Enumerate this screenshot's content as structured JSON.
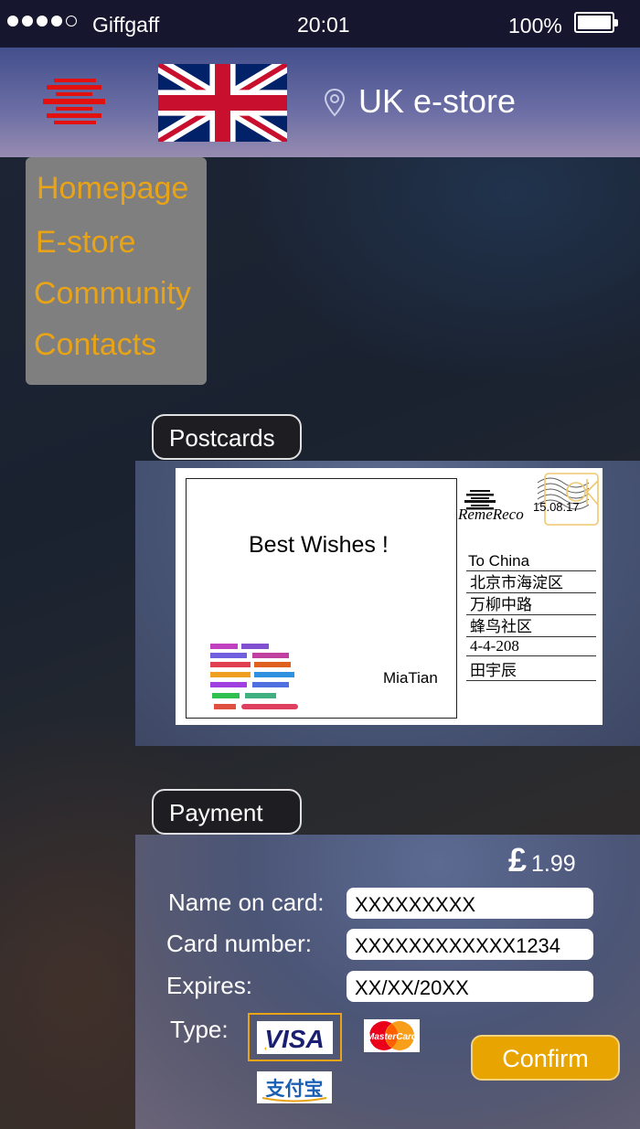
{
  "status_bar": {
    "carrier": "Giffgaff",
    "time": "20:01",
    "battery": "100%",
    "signal_bars": 4,
    "signal_max": 5
  },
  "header": {
    "title": "UK e-store",
    "menu_icon": "menu-logo-icon",
    "flag_icon": "uk-flag-icon",
    "location_icon": "location-pin-icon"
  },
  "nav": {
    "items": [
      "Homepage",
      "E-store",
      "Community",
      "Contacts"
    ]
  },
  "postcards": {
    "section_label": "Postcards",
    "message": "Best Wishes !",
    "signature": "MiaTian",
    "stamp_brand": "RemeReco",
    "stamp_date": "15.08.17",
    "address": [
      "To China",
      "北京市海淀区",
      "万柳中路",
      "蜂鸟社区",
      "4-4-208",
      "田宇辰"
    ]
  },
  "payment": {
    "section_label": "Payment",
    "currency_symbol": "£",
    "price": "1.99",
    "name_label": "Name on card:",
    "name_value": "XXXXXXXXX",
    "number_label": "Card number:",
    "number_value": "XXXXXXXXXXXX1234",
    "expires_label": "Expires:",
    "expires_value": "XX/XX/20XX",
    "type_label": "Type:",
    "card_types": [
      "VISA",
      "MasterCard",
      "支付宝"
    ],
    "selected_type": "VISA",
    "confirm_label": "Confirm"
  },
  "colors": {
    "accent": "#e8a317",
    "header": "#5a5f99",
    "status_bar": "#16162e"
  }
}
